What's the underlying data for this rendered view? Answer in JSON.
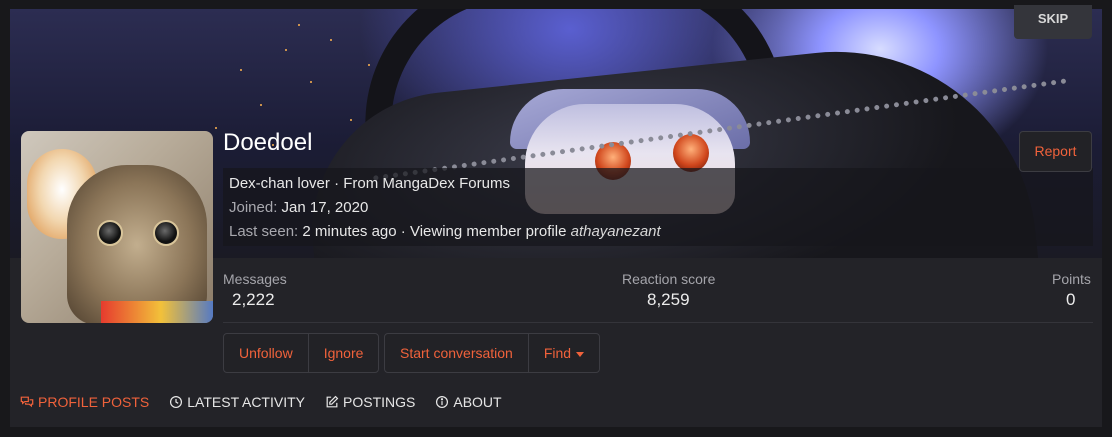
{
  "banner": {
    "skip_label": "SKIP"
  },
  "profile": {
    "username": "Doedoel",
    "title": "Dex-chan lover",
    "location_text": "From MangaDex Forums",
    "joined_label": "Joined:",
    "joined_date": "Jan 17, 2020",
    "last_seen_label": "Last seen:",
    "last_seen_value": "2 minutes ago",
    "activity_text": "Viewing member profile",
    "activity_target": "athayanezant",
    "report_label": "Report"
  },
  "stats": [
    {
      "label": "Messages",
      "value": "2,222"
    },
    {
      "label": "Reaction score",
      "value": "8,259"
    },
    {
      "label": "Points",
      "value": "0"
    }
  ],
  "actions": {
    "unfollow": "Unfollow",
    "ignore": "Ignore",
    "start_conversation": "Start conversation",
    "find": "Find"
  },
  "tabs": [
    {
      "label": "PROFILE POSTS",
      "icon": "comments-icon",
      "active": true
    },
    {
      "label": "LATEST ACTIVITY",
      "icon": "clock-icon",
      "active": false
    },
    {
      "label": "POSTINGS",
      "icon": "edit-icon",
      "active": false
    },
    {
      "label": "ABOUT",
      "icon": "info-icon",
      "active": false
    }
  ],
  "colors": {
    "accent": "#f0623b",
    "background": "#18181b",
    "panel": "#232328"
  }
}
